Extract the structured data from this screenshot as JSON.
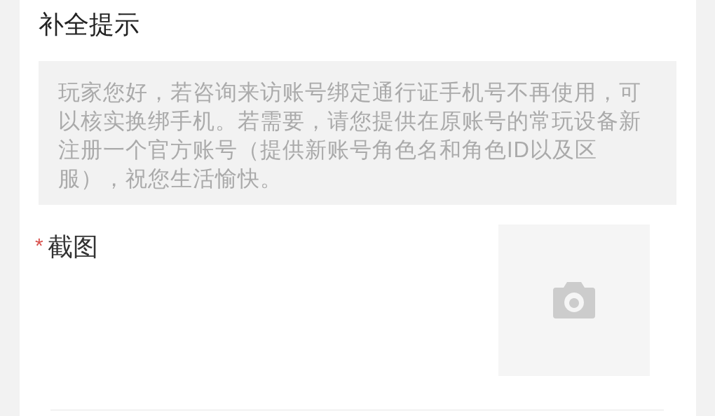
{
  "section_title": "补全提示",
  "hint": "玩家您好，若咨询来访账号绑定通行证手机号不再使用，可以核实换绑手机。若需要，请您提供在原账号的常玩设备新注册一个官方账号（提供新账号角色名和角色ID以及区服），祝您生活愉快。",
  "screenshot_field": {
    "label": "截图",
    "required": true,
    "required_marker": "*"
  }
}
